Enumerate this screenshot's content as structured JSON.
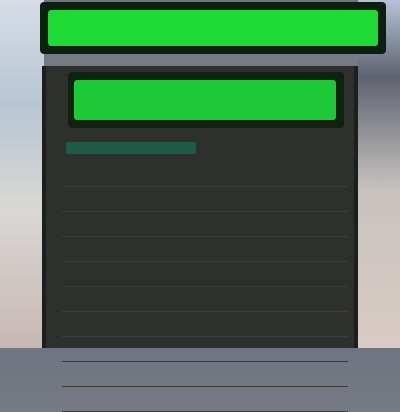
{
  "banner": {
    "text": ""
  },
  "panel": {
    "header": "",
    "section": "",
    "rows": [
      {
        "label": "",
        "value": ""
      },
      {
        "label": "",
        "value": ""
      },
      {
        "label": "",
        "value": ""
      },
      {
        "label": "",
        "value": ""
      },
      {
        "label": "",
        "value": ""
      },
      {
        "label": "",
        "value": ""
      },
      {
        "label": "",
        "value": ""
      },
      {
        "label": "",
        "value": ""
      },
      {
        "label": "",
        "value": ""
      },
      {
        "label": "",
        "value": ""
      }
    ]
  },
  "colors": {
    "accent": "#1fd935",
    "panel_bg": "#2d302d",
    "section": "#1d5b47"
  }
}
